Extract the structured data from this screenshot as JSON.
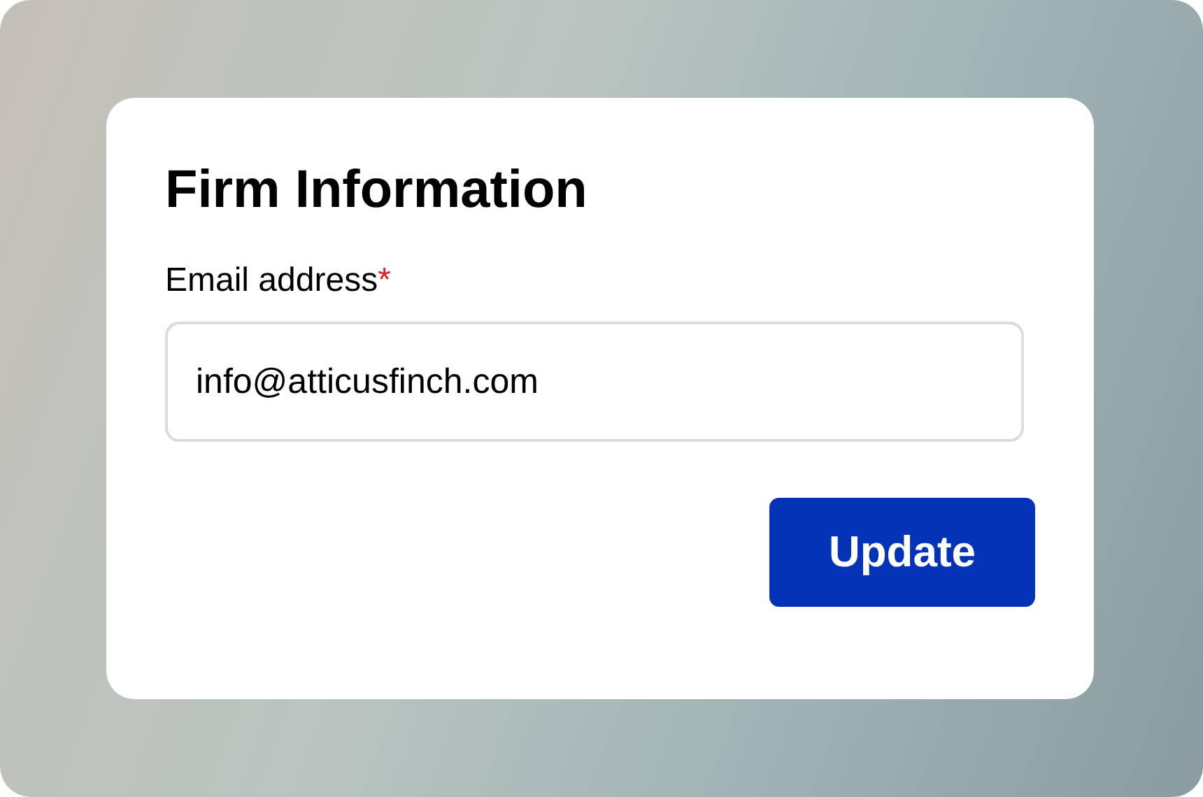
{
  "card": {
    "title": "Firm Information"
  },
  "field": {
    "label": "Email address",
    "required_mark": "*",
    "value": "info@atticusfinch.com"
  },
  "button": {
    "label": "Update"
  }
}
